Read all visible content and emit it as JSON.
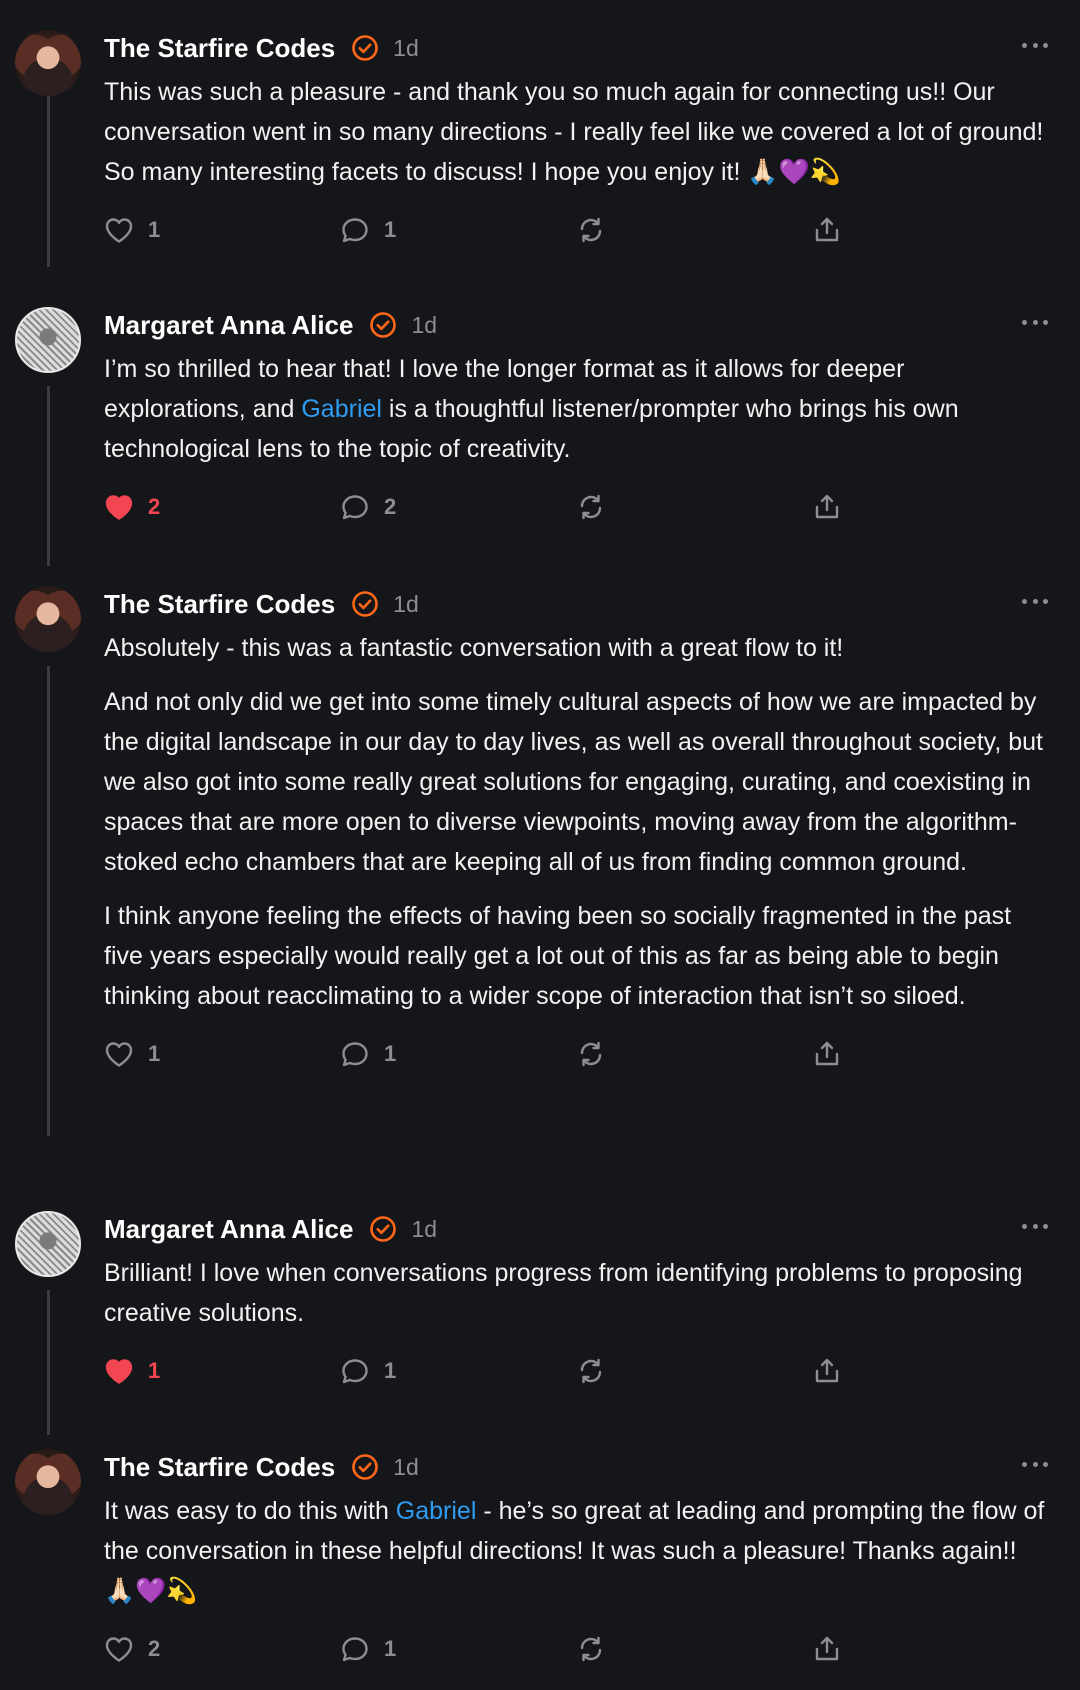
{
  "comments": [
    {
      "author": "The Starfire Codes",
      "avatar": "starfire-avatar",
      "time": "1d",
      "paragraphs": [
        "This was such a pleasure - and thank you so much again for connecting us!! Our conversation went in so many directions - I really feel like we covered a lot of ground! So many interesting facets to discuss! I hope you enjoy it! 🙏🏻💜💫"
      ],
      "likes": "1",
      "liked": false,
      "replies": "1"
    },
    {
      "author": "Margaret Anna Alice",
      "avatar": "margaret-avatar",
      "time": "1d",
      "p_before": "I’m so thrilled to hear that! I love the longer format as it allows for deeper explorations, and ",
      "mention": "Gabriel",
      "p_after": " is a thoughtful listener/prompter who brings his own technological lens to the topic of creativity.",
      "likes": "2",
      "liked": true,
      "replies": "2"
    },
    {
      "author": "The Starfire Codes",
      "avatar": "starfire-avatar",
      "time": "1d",
      "paragraphs": [
        "Absolutely - this was a fantastic conversation with a great flow to it!",
        "And not only did we get into some timely cultural aspects of how we are impacted by the digital landscape in our day to day lives, as well as overall throughout society, but we also got into some really great solutions for engaging, curating, and coexisting in spaces that are more open to diverse viewpoints, moving away from the algorithm-stoked echo chambers that are keeping all of us from finding common ground.",
        "I think anyone feeling the effects of having been so socially fragmented in the past five years especially would really get a lot out of this as far as being able to begin thinking about reacclimating to a wider scope of interaction that isn’t so siloed."
      ],
      "likes": "1",
      "liked": false,
      "replies": "1"
    },
    {
      "author": "Margaret Anna Alice",
      "avatar": "margaret-avatar",
      "time": "1d",
      "paragraphs": [
        "Brilliant! I love when conversations progress from identifying problems to proposing creative solutions."
      ],
      "likes": "1",
      "liked": true,
      "replies": "1"
    },
    {
      "author": "The Starfire Codes",
      "avatar": "starfire-avatar",
      "time": "1d",
      "p_before": "It was easy to do this with ",
      "mention": "Gabriel",
      "p_after": " - he’s so great at leading and prompting the flow of the conversation in these helpful directions! It was such a pleasure! Thanks again!! 🙏🏻💜💫",
      "likes": "2",
      "liked": false,
      "replies": "1"
    }
  ],
  "colors": {
    "background": "#151619",
    "verified": "#ff6719",
    "mention": "#2f9bf1",
    "liked": "#f24653",
    "muted": "#8d8e93"
  }
}
